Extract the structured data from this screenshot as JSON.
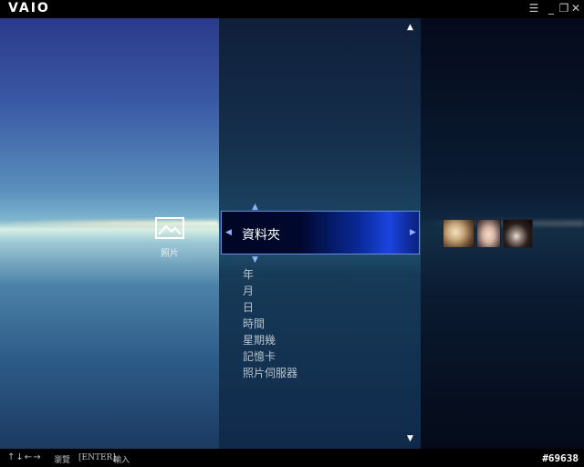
{
  "titlebar": {
    "logo": "VAIO",
    "buttons": {
      "menu": "☰",
      "minimize": "_",
      "restore": "❐",
      "close": "✕"
    }
  },
  "category": {
    "label": "照片"
  },
  "selected_item": {
    "label": "資料夾"
  },
  "menu_items": [
    "年",
    "月",
    "日",
    "時間",
    "星期幾",
    "記憶卡",
    "照片伺服器"
  ],
  "statusbar": {
    "nav_arrows": "↑↓←→",
    "browse": "瀏覽",
    "enter": "[ENTER]",
    "input": "輸入",
    "watermark": "#69638"
  },
  "colors": {
    "selected_border": "#6a8dd8",
    "selected_accent": "#1b44e0",
    "menu_text": "#b7c3cf"
  }
}
